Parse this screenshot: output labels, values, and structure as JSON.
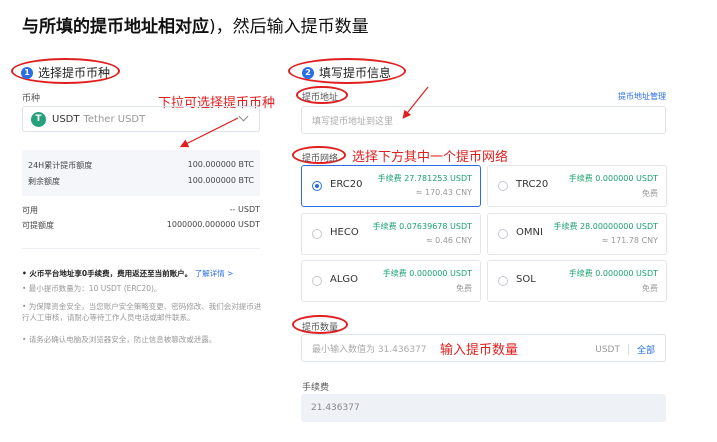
{
  "heading": {
    "bold": "与所填的提币地址相对应",
    "rest": ")，然后输入提币数量"
  },
  "left": {
    "step_num": "1",
    "title": "选择提币币种",
    "coin_label": "币种",
    "coin_logo": "T",
    "coin_symbol": "USDT",
    "coin_name": "Tether USDT",
    "annotation": "下拉可选择提币币种",
    "quota_label": "24H累计提币额度",
    "quota_value": "100.000000 BTC",
    "remain_label": "剩余额度",
    "remain_value": "100.000000 BTC",
    "available_label": "可用",
    "available_value": "-- USDT",
    "withdrawable_label": "可提额度",
    "withdrawable_value": "1000000.000000 USDT",
    "notes": {
      "n1_text": "• 火币平台地址享0手续费，费用返还至当前账户。",
      "n1_link": "了解详情 >",
      "n2": "• 最小提币数量为：10 USDT (ERC20)。",
      "n3": "• 为保障资金安全，当您账户安全策略变更、密码修改、我们会对提币进行人工审核，请耐心等待工作人员电话或邮件联系。",
      "n4": "• 请务必确认电脑及浏览器安全，防止信息被篡改或泄露。"
    }
  },
  "right": {
    "step_num": "2",
    "title": "填写提币信息",
    "address_label": "提币地址",
    "address_mgmt": "提币地址管理",
    "address_placeholder": "填写提币地址到这里",
    "network_label": "提币网络",
    "network_annotation": "选择下方其中一个提币网络",
    "networks": [
      {
        "name": "ERC20",
        "fee": "手续费 27.781253 USDT",
        "cny": "≈ 170.43 CNY",
        "selected": true
      },
      {
        "name": "TRC20",
        "fee": "手续费 0.000000 USDT",
        "cny": "免费",
        "selected": false
      },
      {
        "name": "HECO",
        "fee": "手续费 0.07639678 USDT",
        "cny": "≈ 0.46 CNY",
        "selected": false
      },
      {
        "name": "OMNI",
        "fee": "手续费 28.00000000 USDT",
        "cny": "≈ 171.78 CNY",
        "selected": false
      },
      {
        "name": "ALGO",
        "fee": "手续费 0.000000 USDT",
        "cny": "免费",
        "selected": false
      },
      {
        "name": "SOL",
        "fee": "手续费 0.000000 USDT",
        "cny": "免费",
        "selected": false
      }
    ],
    "amount_label": "提币数量",
    "amount_placeholder": "最小输入数值为 31.436377",
    "amount_annotation": "输入提币数量",
    "amount_unit": "USDT",
    "amount_all": "全部",
    "fee_label": "手续费",
    "fee_value": "21.436377"
  },
  "colors": {
    "accent": "#2a6ee6",
    "annotation_red": "#e02020",
    "fee_green": "#1aa06f",
    "tether_green": "#26a17b"
  }
}
